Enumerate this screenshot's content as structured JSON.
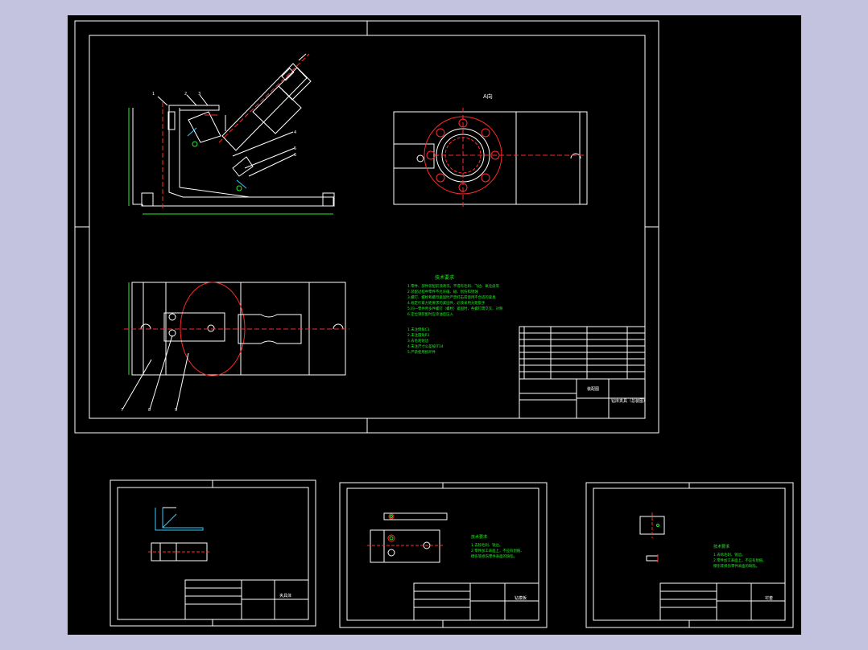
{
  "colors": {
    "background_outer": "#c3c3df",
    "canvas": "#000000",
    "line_white": "#ffffff",
    "line_red": "#ff2a2a",
    "line_green": "#22ee22",
    "line_cyan": "#33ccff"
  },
  "main_sheet": {
    "view_label": "A向",
    "tech_requirements_title": "技术要求",
    "tech_requirements": [
      "1.零件、部件装配前须清洗，不得有毛刺、飞边、氧化皮等",
      "2.装配过程中零件不允许磕、碰、划伤和锈蚀",
      "3.螺钉、螺栓和螺母紧固时严禁打击或使用不合适的旋具",
      "4.规定拧紧力矩要求的紧固件，必须采用力矩扳手",
      "5.同一零件用多件螺钉（螺栓）紧固时，各螺钉需交叉、对称",
      "6.定位销装配时应涂油后压入"
    ],
    "tech_requirements_2": [
      "1.未注倒角C1",
      "2.未注圆角R1",
      "3.去毛刺锐边",
      "4.未注尺寸公差按IT14",
      "5.严禁使用损坏件"
    ],
    "title_block_name": "钻床夹具（总装图）",
    "title_block_drawing_no": "装配图",
    "balloons_left": [
      "1",
      "2",
      "3"
    ],
    "balloons_right": [
      "4",
      "5",
      "6"
    ],
    "balloons_bottom": [
      "7",
      "8",
      "9"
    ]
  },
  "sheet_2": {
    "title_block_name": "夹具体"
  },
  "sheet_3": {
    "tech_requirements_title": "技术要求",
    "tech_requirements": [
      "1.去除毛刺、锐边。",
      "2.零件加工表面上，不应有划痕、",
      "   擦伤等损伤零件表面的缺陷。"
    ],
    "title_block_name": "钻模板"
  },
  "sheet_4": {
    "tech_requirements_title": "技术要求",
    "tech_requirements": [
      "1.去除毛刺、锐边。",
      "2.零件加工表面上，不应有划痕、",
      "   擦伤等损伤零件表面的缺陷。"
    ],
    "title_block_name": "衬套"
  }
}
